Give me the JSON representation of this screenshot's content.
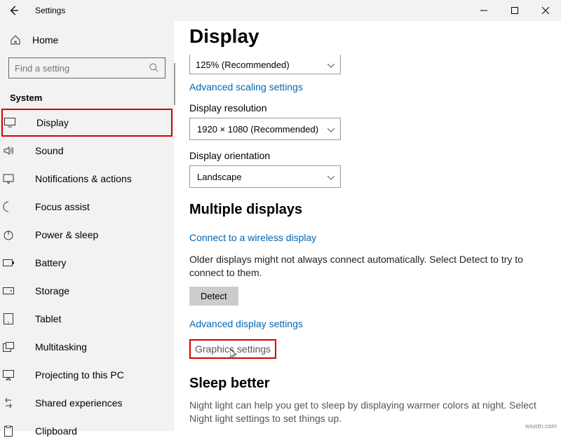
{
  "titlebar": {
    "title": "Settings"
  },
  "sidebar": {
    "home": "Home",
    "search_placeholder": "Find a setting",
    "category": "System",
    "items": [
      {
        "label": "Display",
        "active": true
      },
      {
        "label": "Sound"
      },
      {
        "label": "Notifications & actions"
      },
      {
        "label": "Focus assist"
      },
      {
        "label": "Power & sleep"
      },
      {
        "label": "Battery"
      },
      {
        "label": "Storage"
      },
      {
        "label": "Tablet"
      },
      {
        "label": "Multitasking"
      },
      {
        "label": "Projecting to this PC"
      },
      {
        "label": "Shared experiences"
      },
      {
        "label": "Clipboard"
      }
    ]
  },
  "content": {
    "title": "Display",
    "scale_value": "125% (Recommended)",
    "link_advanced_scaling": "Advanced scaling settings",
    "resolution_label": "Display resolution",
    "resolution_value": "1920 × 1080 (Recommended)",
    "orientation_label": "Display orientation",
    "orientation_value": "Landscape",
    "multiple_displays": "Multiple displays",
    "link_wireless": "Connect to a wireless display",
    "older_desc": "Older displays might not always connect automatically. Select Detect to try to connect to them.",
    "detect_btn": "Detect",
    "link_advanced_display": "Advanced display settings",
    "graphics_link": "Graphics settings",
    "sleep_title": "Sleep better",
    "sleep_desc": "Night light can help you get to sleep by displaying warmer colors at night. Select Night light settings to set things up."
  },
  "watermark": "wsxdn.com"
}
